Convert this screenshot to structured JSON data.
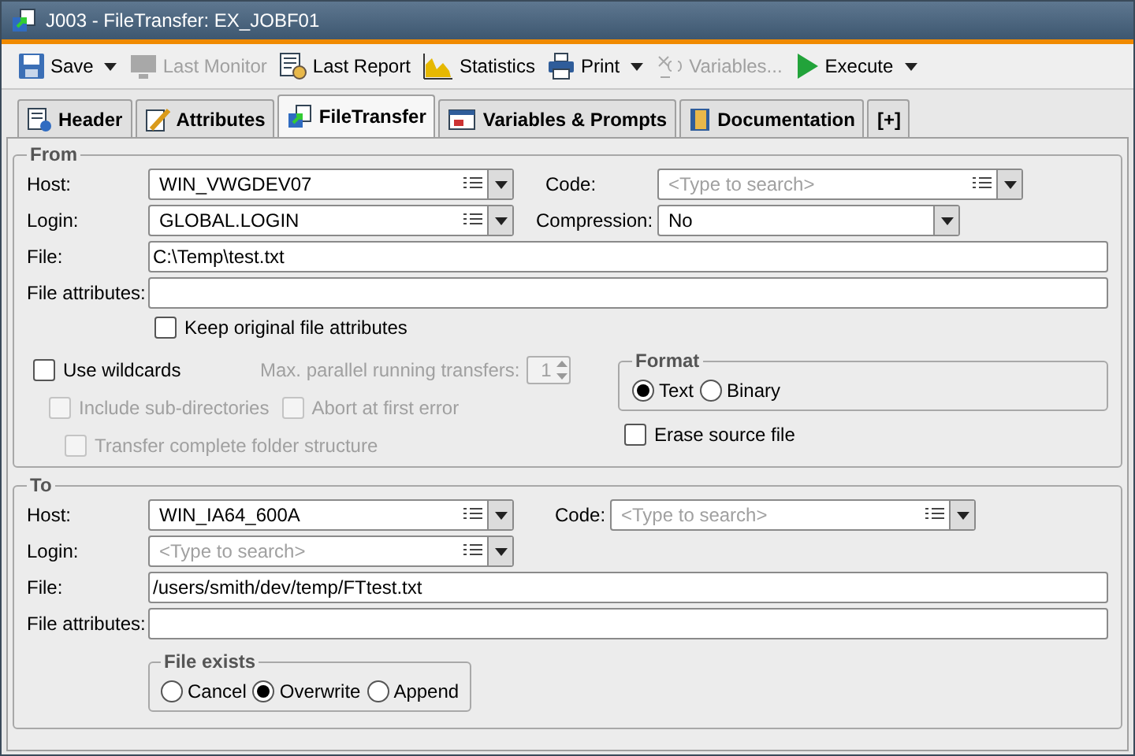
{
  "window": {
    "title": "J003 - FileTransfer: EX_JOBF01"
  },
  "toolbar": [
    {
      "kind": "save",
      "label": "Save",
      "dropdown": true,
      "disabled": false
    },
    {
      "kind": "monitor",
      "label": "Last Monitor",
      "dropdown": false,
      "disabled": true
    },
    {
      "kind": "report",
      "label": "Last Report",
      "dropdown": false,
      "disabled": false
    },
    {
      "kind": "chart",
      "label": "Statistics",
      "dropdown": false,
      "disabled": false
    },
    {
      "kind": "print",
      "label": "Print",
      "dropdown": true,
      "disabled": false
    },
    {
      "kind": "variables",
      "label": "Variables...",
      "dropdown": false,
      "disabled": true
    },
    {
      "kind": "execute",
      "label": "Execute",
      "dropdown": true,
      "disabled": false
    }
  ],
  "tabs": [
    {
      "kind": "header",
      "label": "Header",
      "selected": false
    },
    {
      "kind": "attributes",
      "label": "Attributes",
      "selected": false
    },
    {
      "kind": "filetransfer",
      "label": "FileTransfer",
      "selected": true
    },
    {
      "kind": "variables",
      "label": "Variables & Prompts",
      "selected": false
    },
    {
      "kind": "documentation",
      "label": "Documentation",
      "selected": false
    },
    {
      "kind": "add",
      "label": "[+]",
      "selected": false
    }
  ],
  "from": {
    "title": "From",
    "host": {
      "label": "Host:",
      "value": "WIN_VWGDEV07"
    },
    "code": {
      "label": "Code:",
      "placeholder": "<Type to search>"
    },
    "login": {
      "label": "Login:",
      "value": "GLOBAL.LOGIN"
    },
    "compression": {
      "label": "Compression:",
      "value": "No"
    },
    "file": {
      "label": "File:",
      "value": "C:\\Temp\\test.txt"
    },
    "file_attributes": {
      "label": "File attributes:"
    },
    "keep_original": {
      "label": "Keep original file attributes",
      "checked": false,
      "disabled": false
    },
    "use_wildcards": {
      "label": "Use wildcards",
      "checked": false,
      "disabled": false
    },
    "max_parallel": {
      "label": "Max. parallel running transfers:",
      "value": "1",
      "disabled": true
    },
    "include_subdirectories": {
      "label": "Include sub-directories",
      "checked": false,
      "disabled": true
    },
    "abort_first_error": {
      "label": "Abort at first error",
      "checked": false,
      "disabled": true
    },
    "transfer_folder_structure": {
      "label": "Transfer complete folder structure",
      "checked": false,
      "disabled": true
    },
    "format": {
      "title": "Format",
      "options": [
        {
          "label": "Text",
          "selected": true
        },
        {
          "label": "Binary",
          "selected": false
        }
      ]
    },
    "erase_source": {
      "label": "Erase source file",
      "checked": false,
      "disabled": false
    }
  },
  "to": {
    "title": "To",
    "host": {
      "label": "Host:",
      "value": "WIN_IA64_600A"
    },
    "code": {
      "label": "Code:",
      "placeholder": "<Type to search>"
    },
    "login": {
      "label": "Login:",
      "placeholder": "<Type to search>"
    },
    "file": {
      "label": "File:",
      "value": "/users/smith/dev/temp/FTtest.txt"
    },
    "file_attributes": {
      "label": "File attributes:"
    },
    "file_exists": {
      "title": "File exists",
      "options": [
        {
          "label": "Cancel",
          "selected": false
        },
        {
          "label": "Overwrite",
          "selected": true
        },
        {
          "label": "Append",
          "selected": false
        }
      ]
    }
  }
}
